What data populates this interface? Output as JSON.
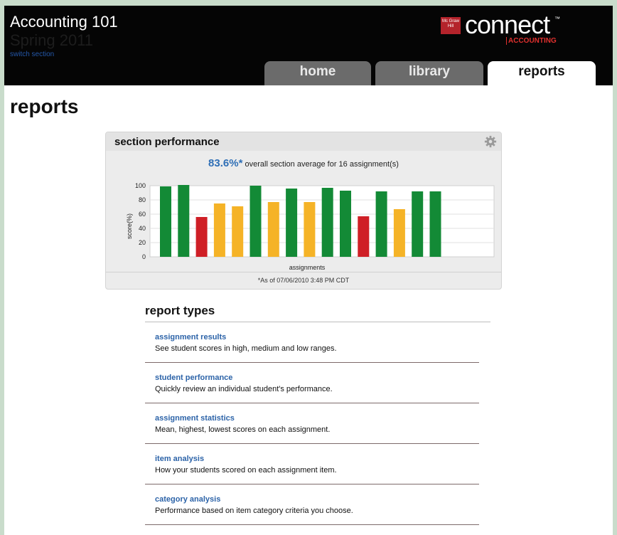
{
  "header": {
    "course_title": "Accounting 101",
    "course_term": "Spring 2011",
    "switch_section": "switch section",
    "logo_text": "connect",
    "logo_tm": "™",
    "logo_sub": "ACCOUNTING",
    "logo_badge": "Mc Graw Hill"
  },
  "tabs": [
    {
      "label": "home",
      "active": false
    },
    {
      "label": "library",
      "active": false
    },
    {
      "label": "reports",
      "active": true
    }
  ],
  "page_title": "reports",
  "panel": {
    "title": "section performance",
    "average_value": "83.6%*",
    "average_text": "overall section average for 16 assignment(s)",
    "footnote": "*As of 07/06/2010 3:48 PM CDT"
  },
  "chart_data": {
    "type": "bar",
    "xlabel": "assignments",
    "ylabel": "score(%)",
    "ylim": [
      0,
      100
    ],
    "yticks": [
      "100",
      "80",
      "60",
      "40",
      "20",
      "0"
    ],
    "grid": true,
    "values": [
      99,
      101,
      56,
      75,
      71,
      100,
      77,
      96,
      77,
      97,
      93,
      57,
      92,
      67,
      92,
      92
    ],
    "colors": [
      "#138a36",
      "#138a36",
      "#cf1f26",
      "#f5b327",
      "#f5b327",
      "#138a36",
      "#f5b327",
      "#138a36",
      "#f5b327",
      "#138a36",
      "#138a36",
      "#cf1f26",
      "#138a36",
      "#f5b327",
      "#138a36",
      "#138a36"
    ]
  },
  "report_types": {
    "heading": "report types",
    "items": [
      {
        "title": "assignment results",
        "description": "See student scores in high, medium and low ranges."
      },
      {
        "title": "student performance",
        "description": "Quickly review an individual student's performance."
      },
      {
        "title": "assignment statistics",
        "description": "Mean, highest, lowest scores on each assignment."
      },
      {
        "title": "item analysis",
        "description": "How your students scored on each assignment item."
      },
      {
        "title": "category analysis",
        "description": "Performance based on item category criteria you choose."
      }
    ]
  },
  "colors": {
    "header_bg": "#050505",
    "link_blue": "#2c63a8",
    "tab_inactive": "#6b6b6b",
    "brand_red": "#e0302e"
  }
}
